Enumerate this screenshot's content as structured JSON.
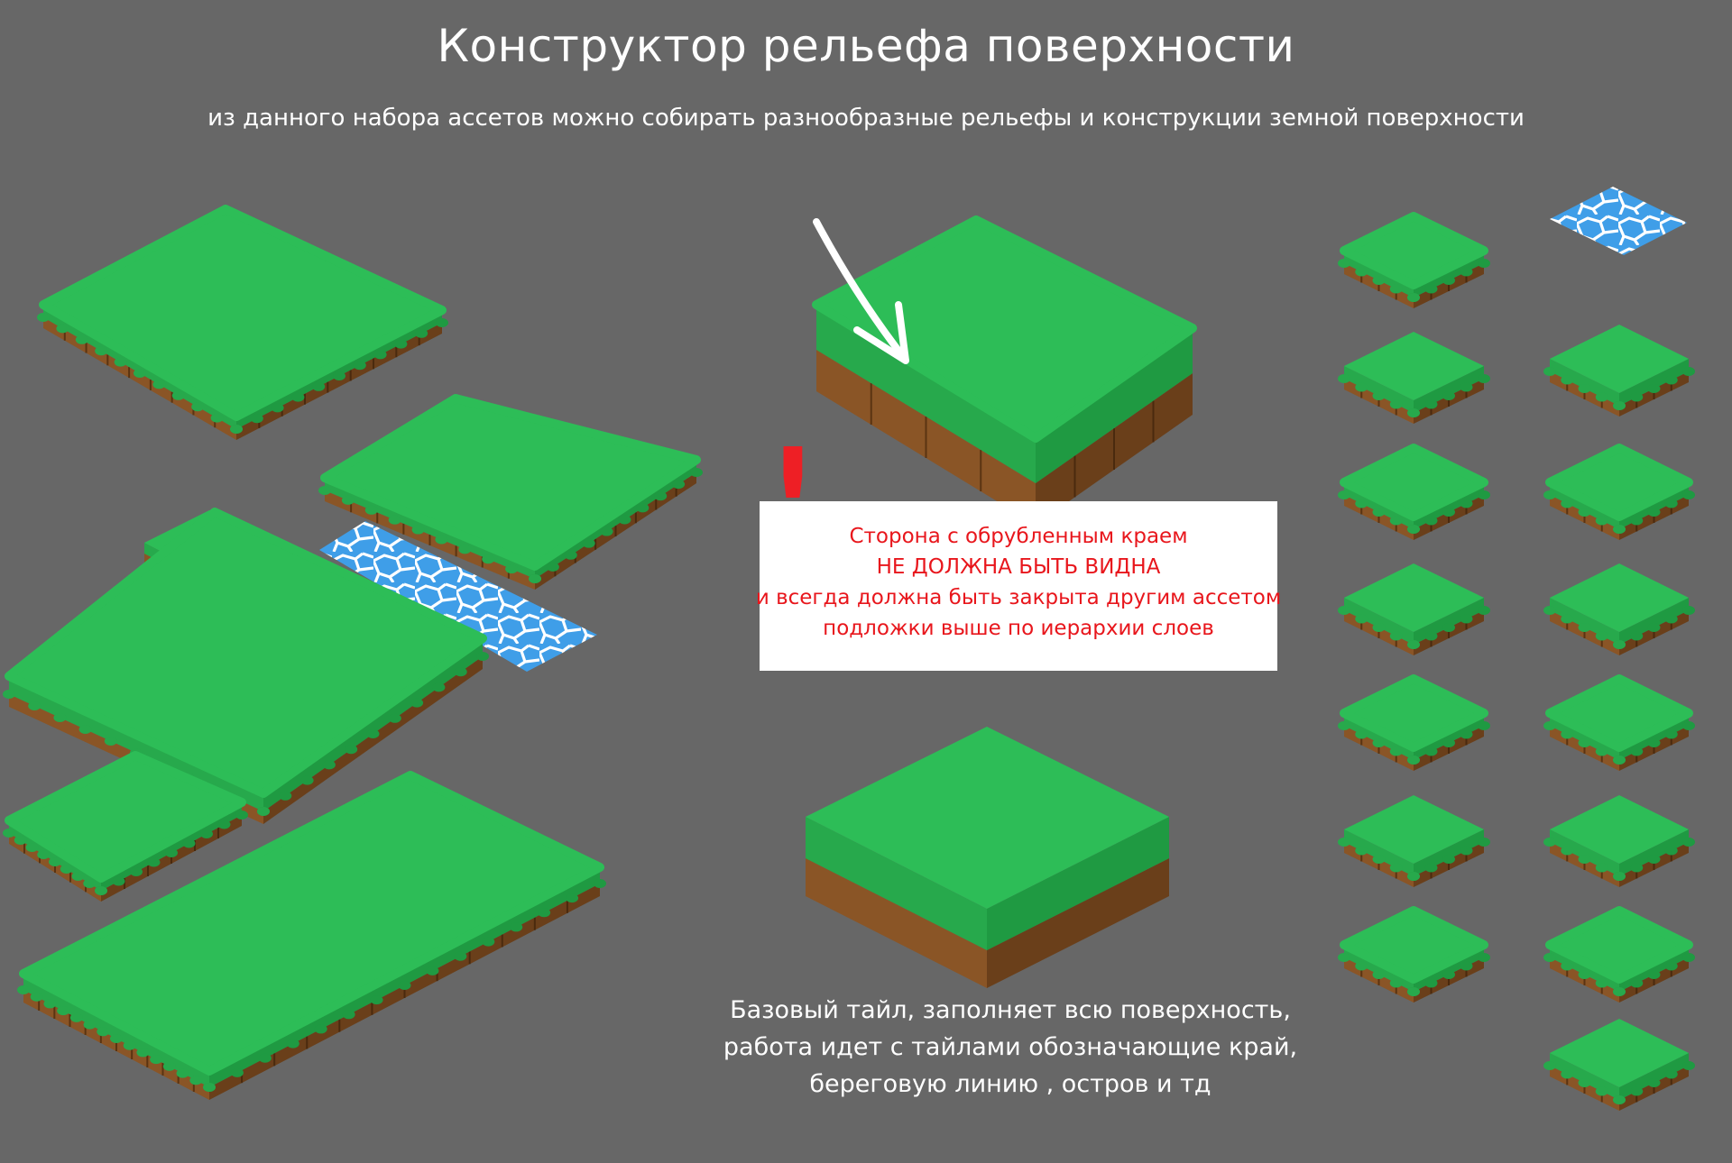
{
  "header": {
    "title": "Конструктор рельефа поверхности",
    "subtitle": "из данного набора ассетов можно собирать разнообразные рельефы и конструкции земной поверхности"
  },
  "warning": {
    "mark": "!",
    "lines": [
      "Сторона с обрубленным краем",
      "НЕ ДОЛЖНА БЫТЬ ВИДНА",
      "и всегда должна быть закрыта другим ассетом",
      "подложки выше по иерархии слоев"
    ]
  },
  "base_tile": {
    "caption_lines": [
      "Базовый тайл, заполняет всю поверхность,",
      "работа идет с тайлами обозначающие край,",
      "береговую линию , остров и тд"
    ]
  },
  "colors": {
    "background": "#676767",
    "grass_top": "#2dbd57",
    "grass_side_left": "#27a94c",
    "grass_side_right": "#1f9a42",
    "soil_left": "#8a5526",
    "soil_right": "#6a3f1a",
    "water": "#3f9ee8",
    "warning_text": "#e8161c"
  }
}
